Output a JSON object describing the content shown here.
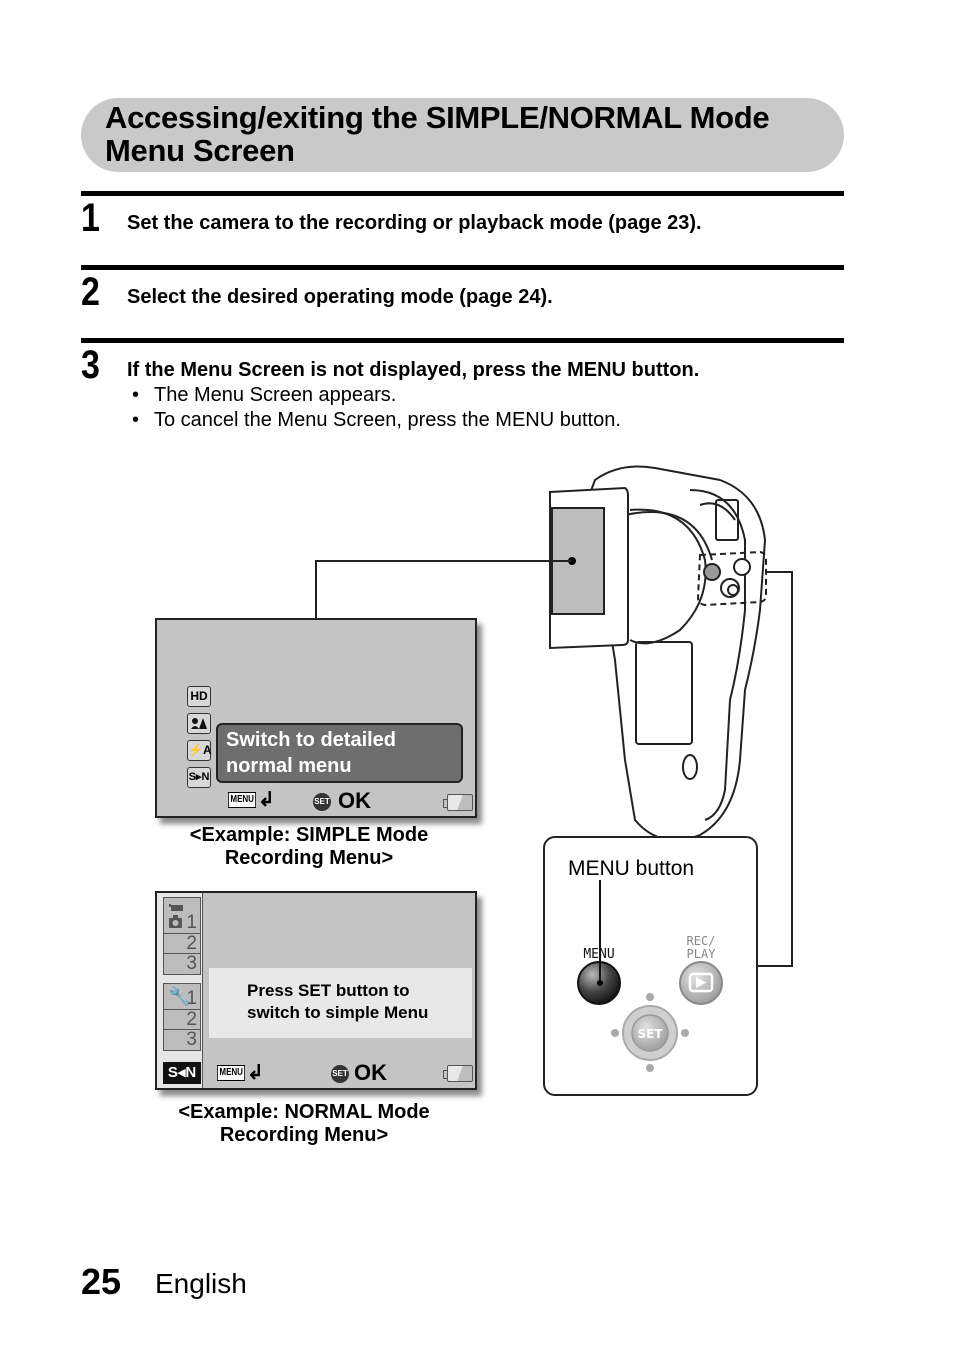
{
  "section": {
    "title": "Accessing/exiting the SIMPLE/NORMAL Mode Menu Screen"
  },
  "steps": [
    {
      "number": "1",
      "text": "Set the camera to the recording or playback mode (page 23).",
      "bullets": []
    },
    {
      "number": "2",
      "text": "Select the desired operating mode (page 24).",
      "bullets": []
    },
    {
      "number": "3",
      "text": "If the Menu Screen is not displayed, press the MENU button.",
      "bullets": [
        "The Menu Screen appears.",
        "To cancel the Menu Screen, press the MENU button."
      ]
    }
  ],
  "bullet_char": "•",
  "simple_screen": {
    "icons": [
      "HD",
      "scene-icon",
      "⚡A",
      "S▸N"
    ],
    "tooltip_line1": "Switch to detailed",
    "tooltip_line2": "normal menu",
    "menu_glyph": "MENU",
    "return_glyph": "↲",
    "set_glyph": "SET",
    "ok_label": "OK",
    "caption_line1": "<Example: SIMPLE Mode",
    "caption_line2": "Recording Menu>"
  },
  "normal_screen": {
    "tab_group1": [
      "1",
      "2",
      "3"
    ],
    "tab_group2": [
      "1",
      "2",
      "3"
    ],
    "sn_badge": "S◂N",
    "message_line1": "Press SET button to",
    "message_line2": "switch to simple Menu",
    "menu_glyph": "MENU",
    "return_glyph": "↲",
    "set_glyph": "SET",
    "ok_label": "OK",
    "caption_line1": "<Example: NORMAL Mode",
    "caption_line2": "Recording Menu>"
  },
  "button_panel": {
    "callout_label": "MENU button",
    "menu_button_label": "MENU",
    "rec_play_label_line1": "REC/",
    "rec_play_label_line2": "PLAY",
    "set_button_label": "SET"
  },
  "footer": {
    "page_number": "25",
    "language": "English"
  }
}
